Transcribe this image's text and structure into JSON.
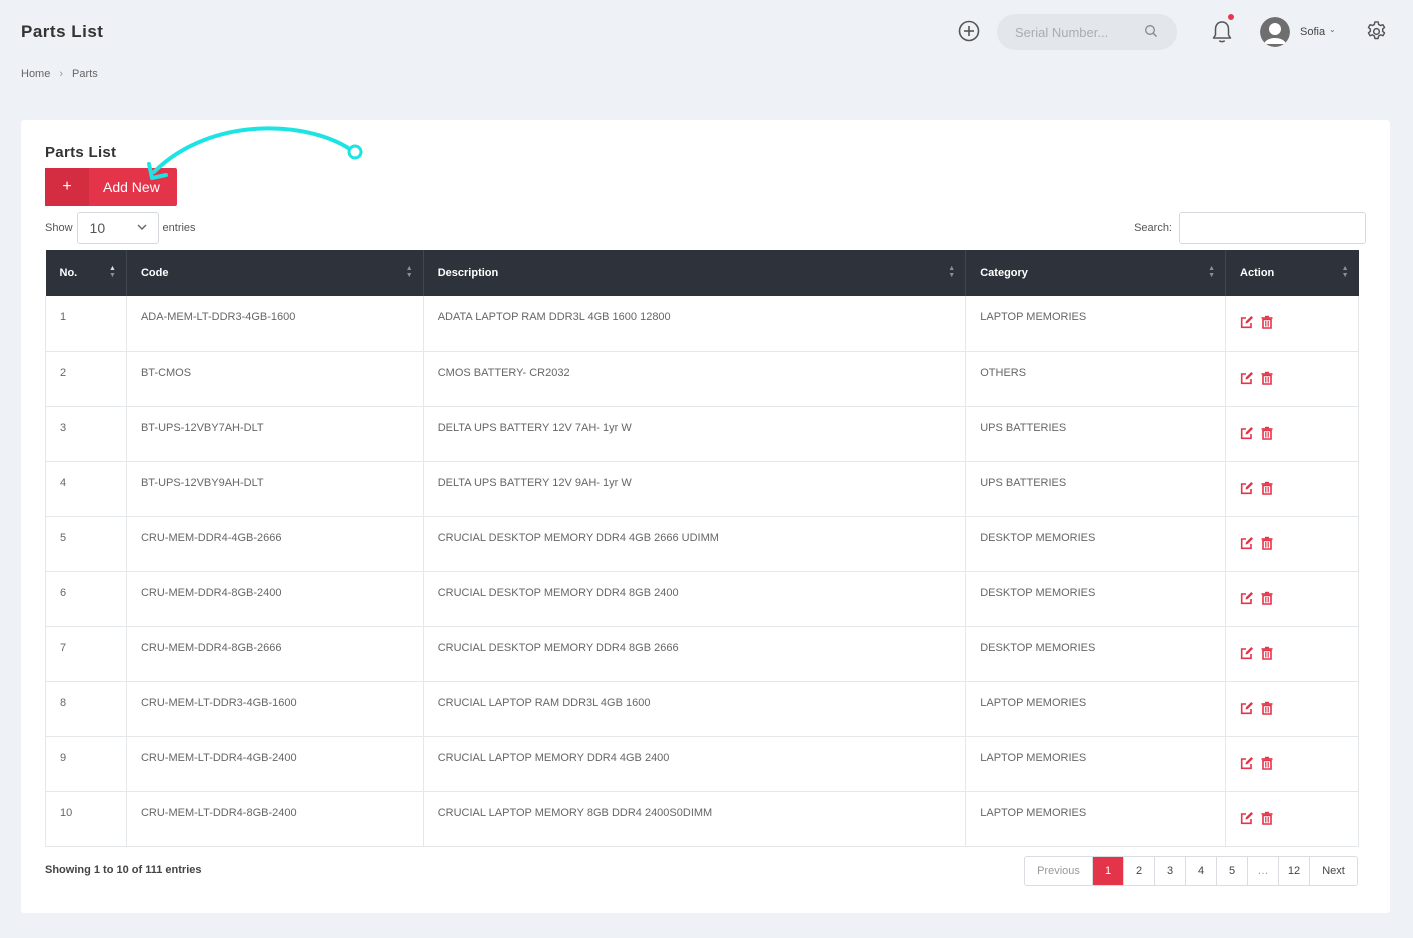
{
  "header": {
    "title": "Parts List",
    "search_placeholder": "Serial Number...",
    "user_name": "Sofia"
  },
  "breadcrumb": {
    "home": "Home",
    "current": "Parts"
  },
  "card": {
    "title": "Parts List",
    "add_label": "Add New",
    "show_label": "Show",
    "entries_label": "entries",
    "entries_value": "10",
    "search_label": "Search:"
  },
  "table": {
    "columns": [
      "No.",
      "Code",
      "Description",
      "Category",
      "Action"
    ],
    "rows": [
      {
        "no": "1",
        "code": "ADA-MEM-LT-DDR3-4GB-1600",
        "desc": "ADATA LAPTOP RAM DDR3L 4GB 1600 12800",
        "cat": "LAPTOP MEMORIES"
      },
      {
        "no": "2",
        "code": "BT-CMOS",
        "desc": "CMOS BATTERY- CR2032",
        "cat": "OTHERS"
      },
      {
        "no": "3",
        "code": "BT-UPS-12VBY7AH-DLT",
        "desc": "DELTA UPS BATTERY 12V 7AH- 1yr W",
        "cat": "UPS BATTERIES"
      },
      {
        "no": "4",
        "code": "BT-UPS-12VBY9AH-DLT",
        "desc": "DELTA UPS BATTERY 12V 9AH- 1yr W",
        "cat": "UPS BATTERIES"
      },
      {
        "no": "5",
        "code": "CRU-MEM-DDR4-4GB-2666",
        "desc": "CRUCIAL DESKTOP MEMORY DDR4 4GB 2666 UDIMM",
        "cat": "DESKTOP MEMORIES"
      },
      {
        "no": "6",
        "code": "CRU-MEM-DDR4-8GB-2400",
        "desc": "CRUCIAL DESKTOP MEMORY DDR4 8GB 2400",
        "cat": "DESKTOP MEMORIES"
      },
      {
        "no": "7",
        "code": "CRU-MEM-DDR4-8GB-2666",
        "desc": "CRUCIAL DESKTOP MEMORY DDR4 8GB 2666",
        "cat": "DESKTOP MEMORIES"
      },
      {
        "no": "8",
        "code": "CRU-MEM-LT-DDR3-4GB-1600",
        "desc": "CRUCIAL LAPTOP RAM DDR3L 4GB 1600",
        "cat": "LAPTOP MEMORIES"
      },
      {
        "no": "9",
        "code": "CRU-MEM-LT-DDR4-4GB-2400",
        "desc": "CRUCIAL LAPTOP MEMORY DDR4 4GB 2400",
        "cat": "LAPTOP MEMORIES"
      },
      {
        "no": "10",
        "code": "CRU-MEM-LT-DDR4-8GB-2400",
        "desc": "CRUCIAL LAPTOP MEMORY 8GB DDR4 2400S0DIMM",
        "cat": "LAPTOP MEMORIES"
      }
    ]
  },
  "footer": {
    "info": "Showing 1 to 10 of 111 entries",
    "pages": [
      "Previous",
      "1",
      "2",
      "3",
      "4",
      "5",
      "…",
      "12",
      "Next"
    ],
    "active_page": "1"
  },
  "colors": {
    "accent": "#e43449",
    "table_header": "#2e333b",
    "annotation_arrow": "#1de3e3"
  },
  "icons": {
    "row_actions": [
      "edit-icon",
      "trash-icon"
    ]
  }
}
